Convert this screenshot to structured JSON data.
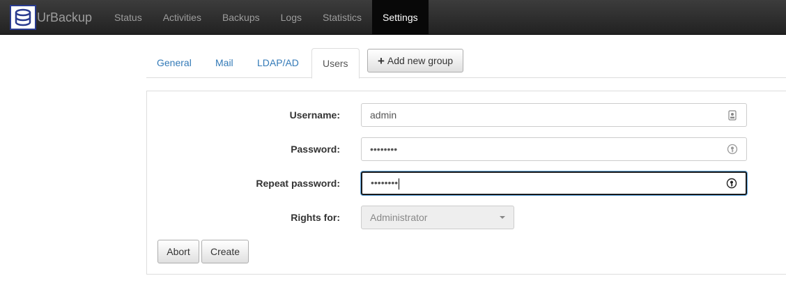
{
  "navbar": {
    "brand": "UrBackup",
    "items": [
      {
        "label": "Status"
      },
      {
        "label": "Activities"
      },
      {
        "label": "Backups"
      },
      {
        "label": "Logs"
      },
      {
        "label": "Statistics"
      },
      {
        "label": "Settings",
        "active": true
      }
    ]
  },
  "tabs": [
    {
      "label": "General"
    },
    {
      "label": "Mail"
    },
    {
      "label": "LDAP/AD"
    },
    {
      "label": "Users",
      "active": true
    }
  ],
  "add_group_label": "Add new group",
  "form": {
    "username": {
      "label": "Username:",
      "value": "admin"
    },
    "password": {
      "label": "Password:",
      "value": "••••••••"
    },
    "repeat_password": {
      "label": "Repeat password:",
      "value": "••••••••"
    },
    "rights": {
      "label": "Rights for:",
      "value": "Administrator"
    }
  },
  "buttons": {
    "abort": "Abort",
    "create": "Create"
  },
  "colors": {
    "navbar_bg": "#222222",
    "link": "#337ab7",
    "brand_border": "#2a3b8f"
  }
}
